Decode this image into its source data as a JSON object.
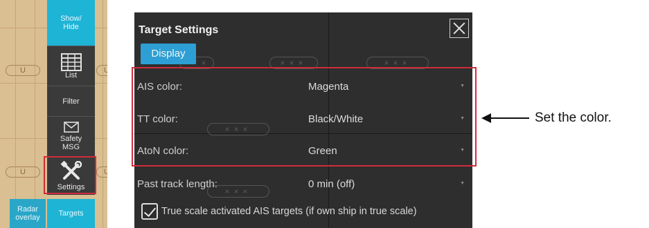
{
  "toolbar": {
    "show_hide": "Show/\nHide",
    "list": "List",
    "filter": "Filter",
    "safety_msg": "Safety\nMSG",
    "settings": "Settings",
    "radar_overlay": "Radar\noverlay",
    "targets": "Targets"
  },
  "chart_pill_letter": "U",
  "ghost_marks": "×××",
  "dialog": {
    "title": "Target Settings",
    "tab_display": "Display",
    "rows": [
      {
        "label": "AIS color:",
        "value": "Magenta"
      },
      {
        "label": "TT color:",
        "value": "Black/White"
      },
      {
        "label": "AtoN color:",
        "value": "Green"
      },
      {
        "label": "Past track length:",
        "value": "0 min (off)"
      }
    ],
    "checkbox_label": "True scale activated AIS targets (if own ship in true scale)",
    "checkbox_checked": true
  },
  "annotation": "Set the color."
}
